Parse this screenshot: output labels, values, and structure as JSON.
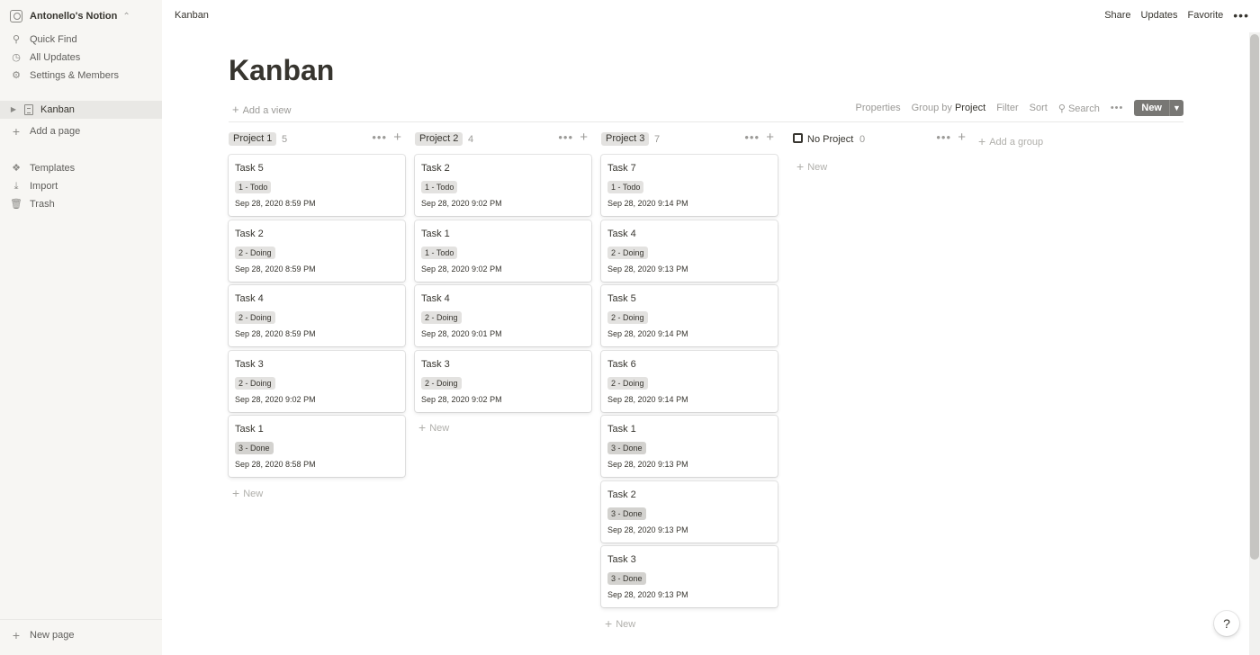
{
  "sidebar": {
    "workspace": "Antonello's Notion",
    "quick_find": "Quick Find",
    "all_updates": "All Updates",
    "settings": "Settings & Members",
    "page_kanban": "Kanban",
    "add_page": "Add a page",
    "templates": "Templates",
    "import": "Import",
    "trash": "Trash",
    "new_page": "New page"
  },
  "topbar": {
    "breadcrumb": "Kanban",
    "share": "Share",
    "updates": "Updates",
    "favorite": "Favorite",
    "more": "•••"
  },
  "page": {
    "title": "Kanban",
    "add_view": "Add a view",
    "properties": "Properties",
    "group_by_label": "Group by",
    "group_by_value": "Project",
    "filter": "Filter",
    "sort": "Sort",
    "search": "Search",
    "more": "•••",
    "new": "New",
    "add_group": "Add a group",
    "new_card": "New"
  },
  "columns": [
    {
      "name": "Project 1",
      "count": "5",
      "cards": [
        {
          "title": "Task 5",
          "status": "1 - Todo",
          "date": "Sep 28, 2020 8:59 PM"
        },
        {
          "title": "Task 2",
          "status": "2 - Doing",
          "date": "Sep 28, 2020 8:59 PM"
        },
        {
          "title": "Task 4",
          "status": "2 - Doing",
          "date": "Sep 28, 2020 8:59 PM"
        },
        {
          "title": "Task 3",
          "status": "2 - Doing",
          "date": "Sep 28, 2020 9:02 PM"
        },
        {
          "title": "Task 1",
          "status": "3 - Done",
          "date": "Sep 28, 2020 8:58 PM"
        }
      ]
    },
    {
      "name": "Project 2",
      "count": "4",
      "cards": [
        {
          "title": "Task 2",
          "status": "1 - Todo",
          "date": "Sep 28, 2020 9:02 PM"
        },
        {
          "title": "Task 1",
          "status": "1 - Todo",
          "date": "Sep 28, 2020 9:02 PM"
        },
        {
          "title": "Task 4",
          "status": "2 - Doing",
          "date": "Sep 28, 2020 9:01 PM"
        },
        {
          "title": "Task 3",
          "status": "2 - Doing",
          "date": "Sep 28, 2020 9:02 PM"
        }
      ]
    },
    {
      "name": "Project 3",
      "count": "7",
      "cards": [
        {
          "title": "Task 7",
          "status": "1 - Todo",
          "date": "Sep 28, 2020 9:14 PM"
        },
        {
          "title": "Task 4",
          "status": "2 - Doing",
          "date": "Sep 28, 2020 9:13 PM"
        },
        {
          "title": "Task 5",
          "status": "2 - Doing",
          "date": "Sep 28, 2020 9:14 PM"
        },
        {
          "title": "Task 6",
          "status": "2 - Doing",
          "date": "Sep 28, 2020 9:14 PM"
        },
        {
          "title": "Task 1",
          "status": "3 - Done",
          "date": "Sep 28, 2020 9:13 PM"
        },
        {
          "title": "Task 2",
          "status": "3 - Done",
          "date": "Sep 28, 2020 9:13 PM"
        },
        {
          "title": "Task 3",
          "status": "3 - Done",
          "date": "Sep 28, 2020 9:13 PM"
        }
      ]
    },
    {
      "name": "No Project",
      "count": "0",
      "cards": []
    }
  ],
  "help": "?"
}
